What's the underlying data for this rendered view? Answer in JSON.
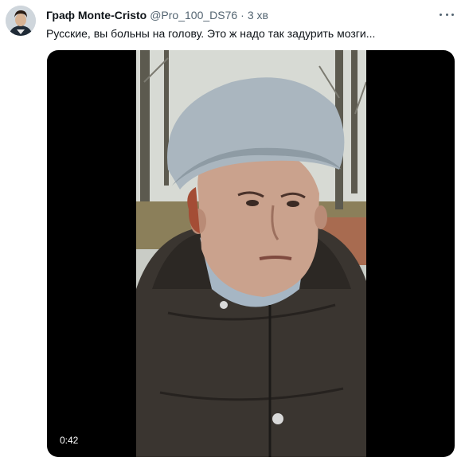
{
  "tweet": {
    "author_name": "Граф Monte-Cristo",
    "author_handle": "@Pro_100_DS76",
    "separator": "·",
    "time": "3 хв",
    "text": "Русские, вы больны на голову. Это ж надо так задурить мозги...",
    "more_icon": "more-horizontal-icon"
  },
  "media": {
    "duration": "0:42"
  }
}
